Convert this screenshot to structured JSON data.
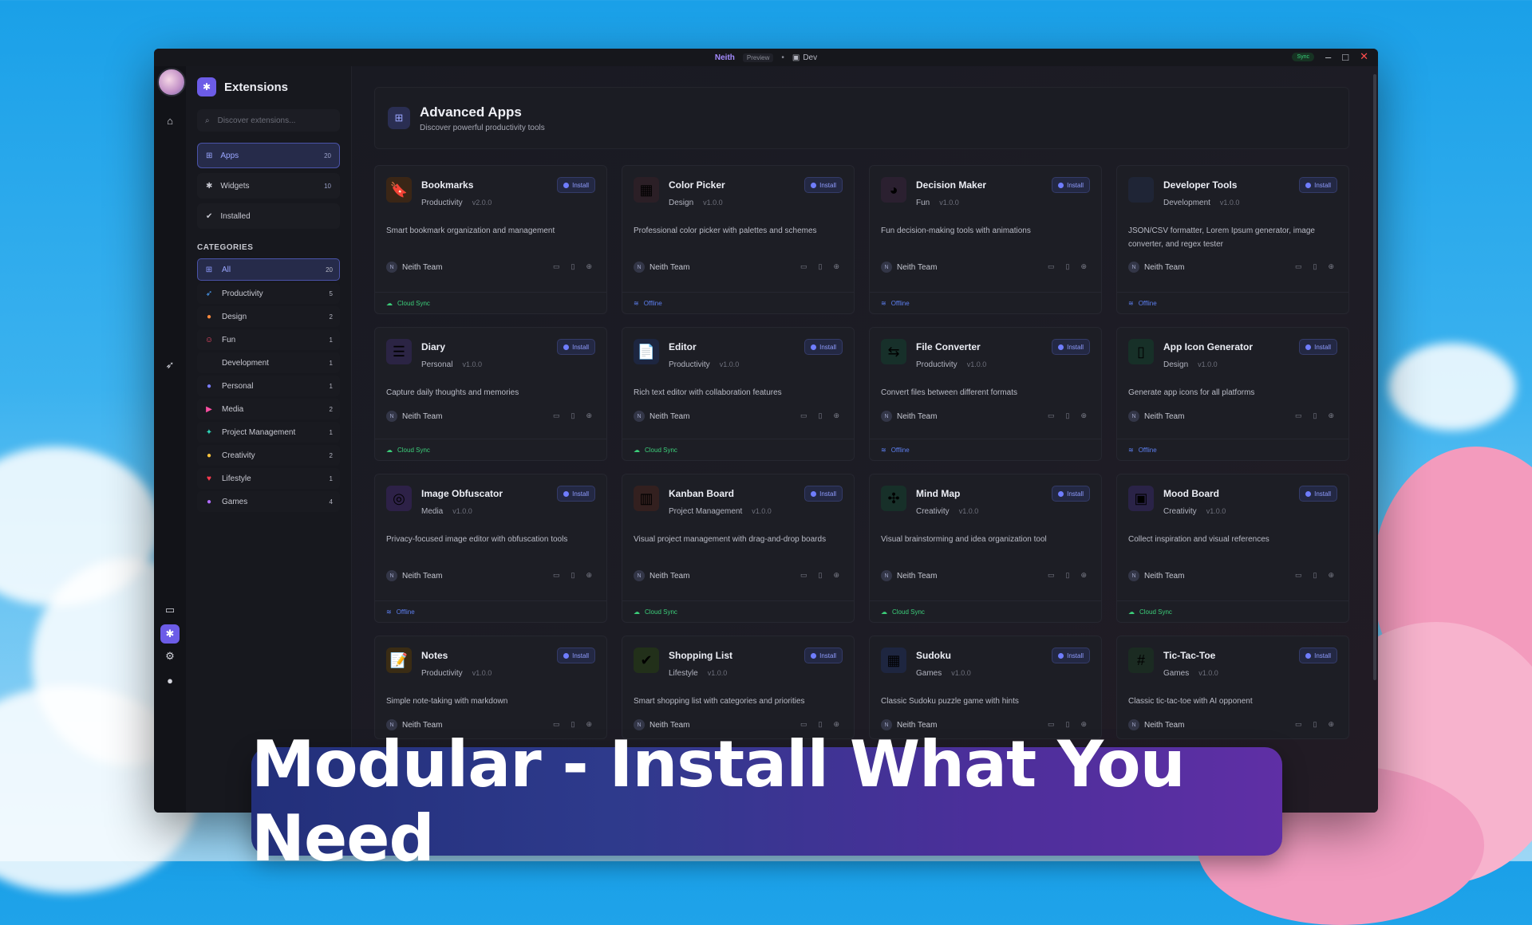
{
  "titlebar": {
    "app": "Neith",
    "preview": "Preview",
    "env": "Dev",
    "sync": "Sync"
  },
  "sidebar": {
    "title": "Extensions",
    "search_placeholder": "Discover extensions...",
    "nav": [
      {
        "label": "Apps",
        "count": "20",
        "icon": "grid-icon"
      },
      {
        "label": "Widgets",
        "count": "10",
        "icon": "puzzle-icon"
      },
      {
        "label": "Installed",
        "count": "",
        "icon": "check-circle-icon"
      }
    ],
    "categories_title": "CATEGORIES",
    "categories": [
      {
        "label": "All",
        "count": "20",
        "icon": "grid-icon",
        "color": "#8f9cff"
      },
      {
        "label": "Productivity",
        "count": "5",
        "icon": "rocket-icon",
        "color": "#4da3ff"
      },
      {
        "label": "Design",
        "count": "2",
        "icon": "palette-icon",
        "color": "#ff8a3d"
      },
      {
        "label": "Fun",
        "count": "1",
        "icon": "smile-icon",
        "color": "#ff4d6d"
      },
      {
        "label": "Development",
        "count": "1",
        "icon": "code-icon",
        "color": "#3ccf7a"
      },
      {
        "label": "Personal",
        "count": "1",
        "icon": "user-icon",
        "color": "#7b7dff"
      },
      {
        "label": "Media",
        "count": "2",
        "icon": "play-icon",
        "color": "#ff4fa3"
      },
      {
        "label": "Project Management",
        "count": "1",
        "icon": "nodes-icon",
        "color": "#2ed3b7"
      },
      {
        "label": "Creativity",
        "count": "2",
        "icon": "bulb-icon",
        "color": "#ffc43d"
      },
      {
        "label": "Lifestyle",
        "count": "1",
        "icon": "heart-icon",
        "color": "#ff3b4f"
      },
      {
        "label": "Games",
        "count": "4",
        "icon": "gamepad-icon",
        "color": "#b06bff"
      }
    ]
  },
  "hero": {
    "title": "Advanced Apps",
    "subtitle": "Discover powerful productivity tools"
  },
  "install_label": "Install",
  "cards": [
    {
      "name": "Bookmarks",
      "category": "Productivity",
      "version": "v2.0.0",
      "desc": "Smart bookmark organization and management",
      "author": "Neith Team",
      "footer": "Cloud Sync",
      "icon": "bookmark-icon",
      "glyph": "🔖",
      "bg": "#3a2616"
    },
    {
      "name": "Color Picker",
      "category": "Design",
      "version": "v1.0.0",
      "desc": "Professional color picker with palettes and schemes",
      "author": "Neith Team",
      "footer": "Offline",
      "icon": "palette-grid-icon",
      "glyph": "▦",
      "bg": "#2b1f26"
    },
    {
      "name": "Decision Maker",
      "category": "Fun",
      "version": "v1.0.0",
      "desc": "Fun decision-making tools with animations",
      "author": "Neith Team",
      "footer": "Offline",
      "icon": "spinner-wheel-icon",
      "glyph": "◕",
      "bg": "#2b2030"
    },
    {
      "name": "Developer Tools",
      "category": "Development",
      "version": "v1.0.0",
      "desc": "JSON/CSV formatter, Lorem Ipsum generator, image converter, and regex tester",
      "author": "Neith Team",
      "footer": "Offline",
      "icon": "code-brackets-icon",
      "glyph": "</>",
      "bg": "#1f2536"
    },
    {
      "name": "Diary",
      "category": "Personal",
      "version": "v1.0.0",
      "desc": "Capture daily thoughts and memories",
      "author": "Neith Team",
      "footer": "Cloud Sync",
      "icon": "diary-icon",
      "glyph": "☰",
      "bg": "#2b2444"
    },
    {
      "name": "Editor",
      "category": "Productivity",
      "version": "v1.0.0",
      "desc": "Rich text editor with collaboration features",
      "author": "Neith Team",
      "footer": "Cloud Sync",
      "icon": "document-icon",
      "glyph": "📄",
      "bg": "#1d2640"
    },
    {
      "name": "File Converter",
      "category": "Productivity",
      "version": "v1.0.0",
      "desc": "Convert files between different formats",
      "author": "Neith Team",
      "footer": "Offline",
      "icon": "file-convert-icon",
      "glyph": "⇆",
      "bg": "#17302a"
    },
    {
      "name": "App Icon Generator",
      "category": "Design",
      "version": "v1.0.0",
      "desc": "Generate app icons for all platforms",
      "author": "Neith Team",
      "footer": "Offline",
      "icon": "phone-icon",
      "glyph": "▯",
      "bg": "#173028"
    },
    {
      "name": "Image Obfuscator",
      "category": "Media",
      "version": "v1.0.0",
      "desc": "Privacy-focused image editor with obfuscation tools",
      "author": "Neith Team",
      "footer": "Offline",
      "icon": "eye-slash-icon",
      "glyph": "◎",
      "bg": "#2d2147"
    },
    {
      "name": "Kanban Board",
      "category": "Project Management",
      "version": "v1.0.0",
      "desc": "Visual project management with drag-and-drop boards",
      "author": "Neith Team",
      "footer": "Cloud Sync",
      "icon": "kanban-icon",
      "glyph": "▥",
      "bg": "#33201f"
    },
    {
      "name": "Mind Map",
      "category": "Creativity",
      "version": "v1.0.0",
      "desc": "Visual brainstorming and idea organization tool",
      "author": "Neith Team",
      "footer": "Cloud Sync",
      "icon": "mind-map-icon",
      "glyph": "✣",
      "bg": "#173029"
    },
    {
      "name": "Mood Board",
      "category": "Creativity",
      "version": "v1.0.0",
      "desc": "Collect inspiration and visual references",
      "author": "Neith Team",
      "footer": "Cloud Sync",
      "icon": "mood-board-icon",
      "glyph": "▣",
      "bg": "#2a2347"
    },
    {
      "name": "Notes",
      "category": "Productivity",
      "version": "v1.0.0",
      "desc": "Simple note-taking with markdown",
      "author": "Neith Team",
      "footer": "",
      "icon": "notepad-icon",
      "glyph": "📝",
      "bg": "#3a2c14"
    },
    {
      "name": "Shopping List",
      "category": "Lifestyle",
      "version": "v1.0.0",
      "desc": "Smart shopping list with categories and priorities",
      "author": "Neith Team",
      "footer": "",
      "icon": "checklist-icon",
      "glyph": "✔",
      "bg": "#22301a"
    },
    {
      "name": "Sudoku",
      "category": "Games",
      "version": "v1.0.0",
      "desc": "Classic Sudoku puzzle game with hints",
      "author": "Neith Team",
      "footer": "",
      "icon": "sudoku-icon",
      "glyph": "▦",
      "bg": "#1e2640"
    },
    {
      "name": "Tic-Tac-Toe",
      "category": "Games",
      "version": "v1.0.0",
      "desc": "Classic tic-tac-toe with AI opponent",
      "author": "Neith Team",
      "footer": "",
      "icon": "tic-tac-toe-icon",
      "glyph": "#",
      "bg": "#1b2b22"
    }
  ],
  "banner": "Modular - Install What You Need"
}
